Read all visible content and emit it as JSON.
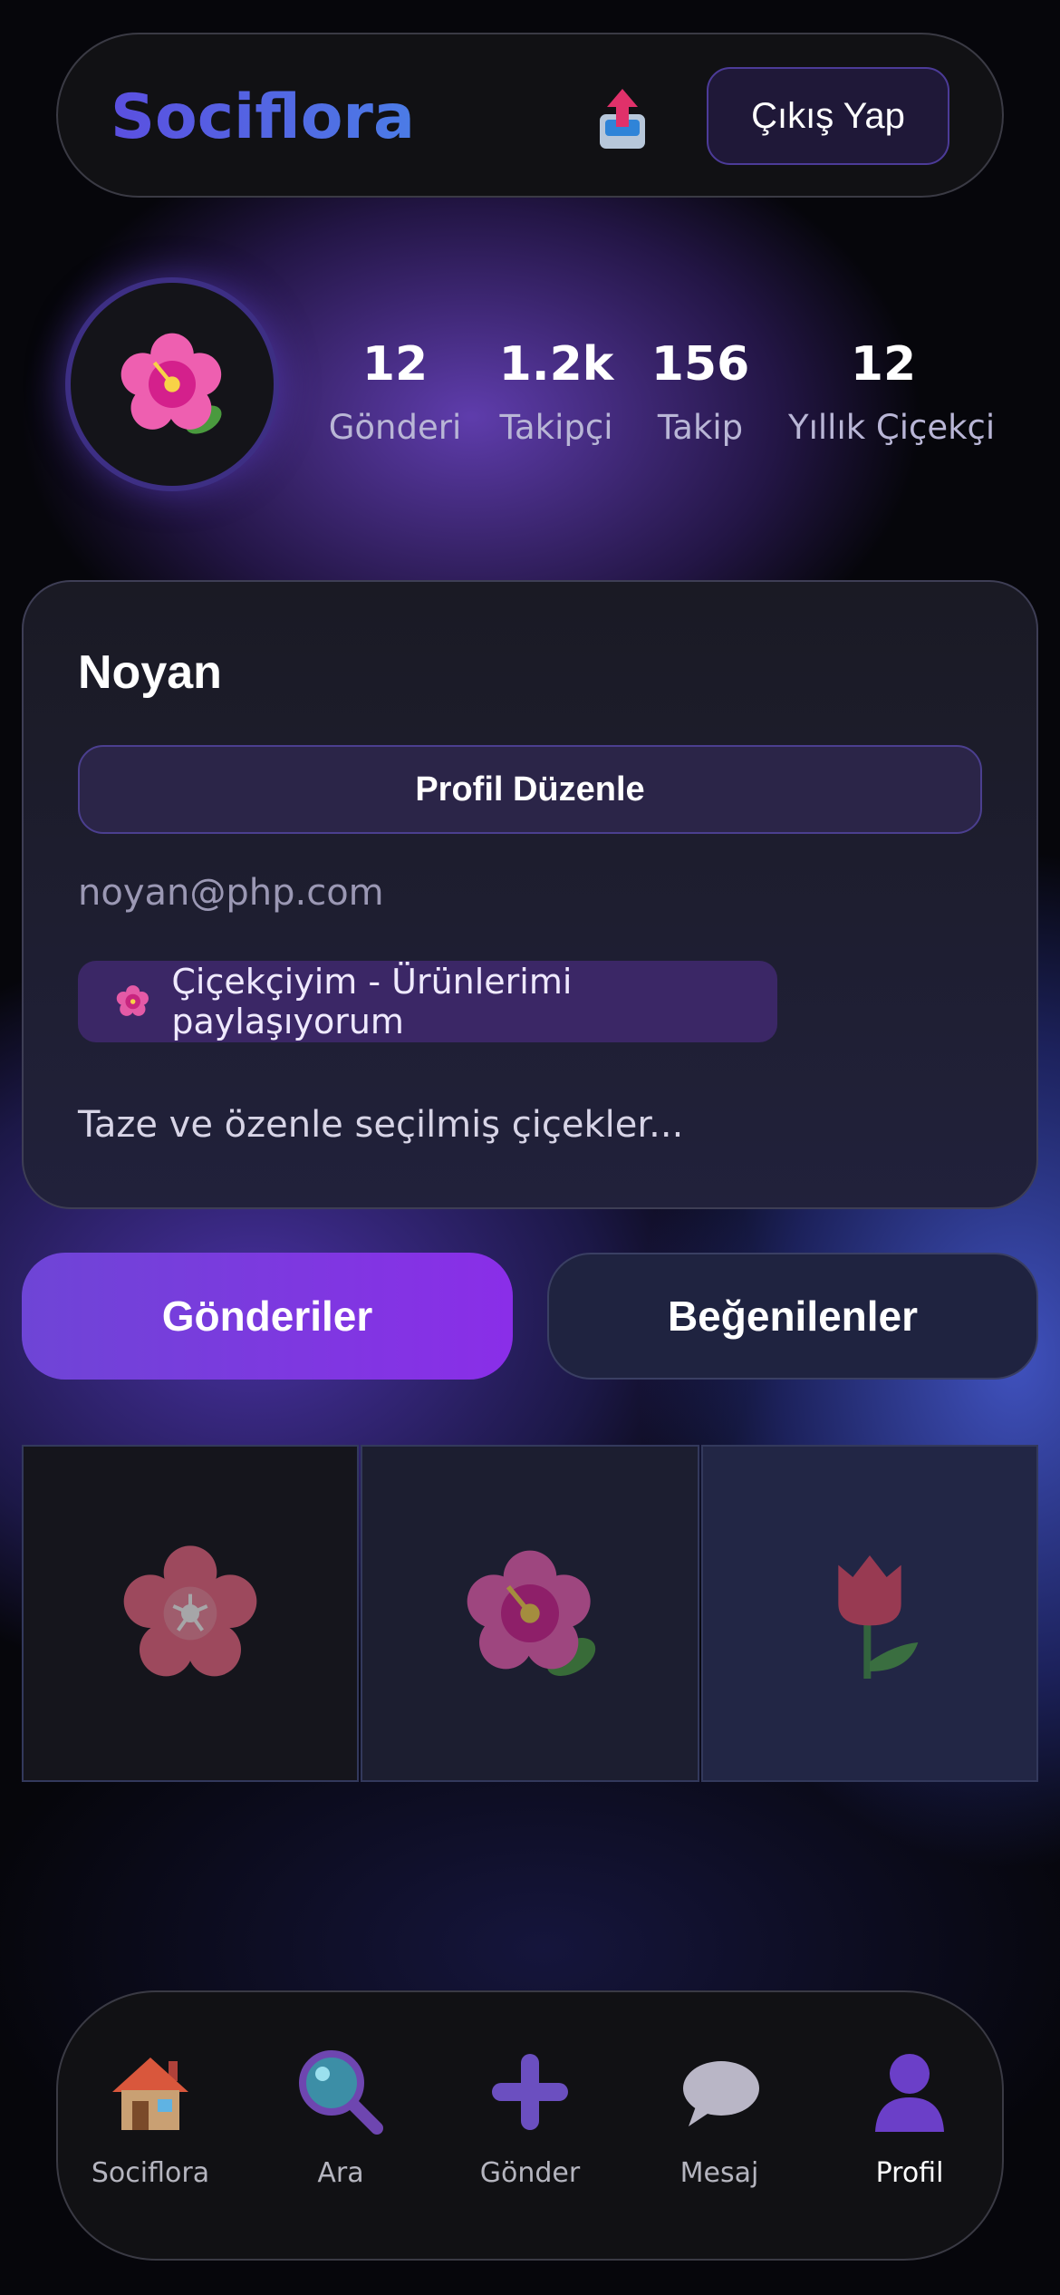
{
  "header": {
    "brand": "Sociflora",
    "logout_label": "Çıkış Yap",
    "upload_icon": "upload-tray-icon"
  },
  "profile": {
    "avatar_icon": "hibiscus-icon",
    "stats": [
      {
        "value": "12",
        "label": "Gönderi"
      },
      {
        "value": "1.2k",
        "label": "Takipçi"
      },
      {
        "value": "156",
        "label": "Takip"
      },
      {
        "value": "12",
        "label": "Yıllık Çiçekçi"
      }
    ],
    "name": "Noyan",
    "edit_label": "Profil Düzenle",
    "email": "noyan@php.com",
    "role": "Çiçekçiyim - Ürünlerimi paylaşıyorum",
    "bio": "Taze ve özenle seçilmiş çiçekler..."
  },
  "tabs": [
    {
      "label": "Gönderiler",
      "active": true
    },
    {
      "label": "Beğenilenler",
      "active": false
    }
  ],
  "posts": [
    {
      "icon": "cherry-blossom-icon"
    },
    {
      "icon": "hibiscus-icon"
    },
    {
      "icon": "tulip-icon"
    }
  ],
  "nav": [
    {
      "label": "Sociflora",
      "icon": "house-icon"
    },
    {
      "label": "Ara",
      "icon": "magnifier-icon"
    },
    {
      "label": "Gönder",
      "icon": "plus-icon"
    },
    {
      "label": "Mesaj",
      "icon": "speech-bubble-icon"
    },
    {
      "label": "Profil",
      "icon": "user-icon",
      "active": true
    }
  ],
  "colors": {
    "accent": "#6e45d6",
    "accent_end": "#8a2ee8",
    "brand": "#5b4fe0",
    "background": "#06060b"
  }
}
